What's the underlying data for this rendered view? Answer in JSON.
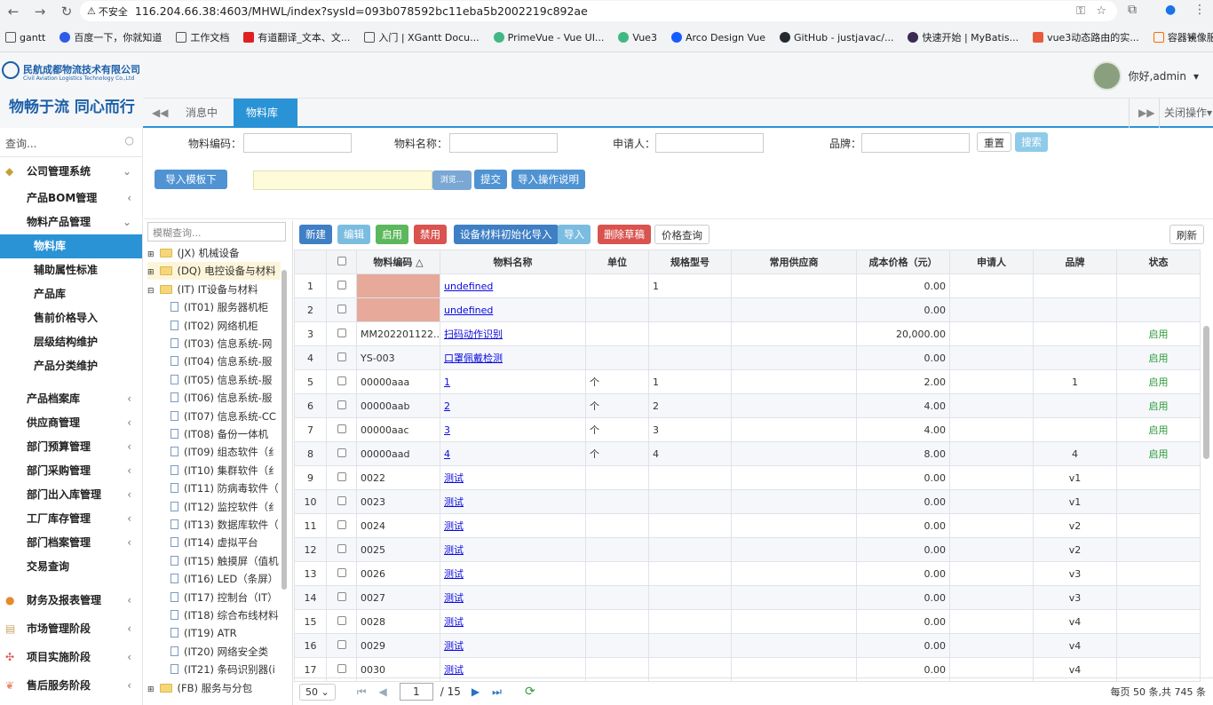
{
  "browser": {
    "insecure_label": "不安全",
    "url": "116.204.66.38:4603/MHWL/index?sysId=093b078592bc11eba5b2002219c892ae",
    "bookmarks": [
      "gantt",
      "百度一下，你就知道",
      "工作文档",
      "有道翻译_文本、文...",
      "入门 | XGantt Docu...",
      "PrimeVue - Vue UI...",
      "Vue3",
      "Arco Design Vue",
      "GitHub - justjavac/...",
      "快速开始 | MyBatis...",
      "vue3动态路由的实...",
      "容器镜像服务"
    ],
    "more": "»"
  },
  "brand": {
    "cn": "民航成都物流技术有限公司",
    "en": "Civil Aviation Logistics Technology Co.,Ltd",
    "slogan": "物畅于流 同心而行"
  },
  "user": {
    "greeting": "你好,admin"
  },
  "tabs": {
    "messages": "消息中心",
    "library": "物料库",
    "close_ops": "关闭操作"
  },
  "sidebar": {
    "search_placeholder": "查询...",
    "group1": "公司管理系统",
    "items": [
      "产品BOM管理",
      "物料产品管理",
      "物料库",
      "辅助属性标准",
      "产品库",
      "售前价格导入",
      "层级结构维护",
      "产品分类维护",
      "产品档案库",
      "供应商管理",
      "部门预算管理",
      "部门采购管理",
      "部门出入库管理",
      "工厂库存管理",
      "部门档案管理",
      "交易查询"
    ],
    "groups": [
      "财务及报表管理",
      "市场管理阶段",
      "项目实施阶段",
      "售后服务阶段"
    ]
  },
  "filter": {
    "code_label": "物料编码：",
    "name_label": "物料名称：",
    "applicant_label": "申请人：",
    "brand_label": "品牌：",
    "reset": "重置",
    "search": "搜索",
    "template": "导入模板下载",
    "browse": "浏览...",
    "submit": "提交",
    "instructions": "导入操作说明"
  },
  "tree": {
    "search_placeholder": "模糊查询...",
    "nodes": [
      "(JX) 机械设备",
      "(DQ) 电控设备与材料",
      "(IT) IT设备与材料",
      "(IT01) 服务器机柜",
      "(IT02) 网络机柜",
      "(IT03) 信息系统-网",
      "(IT04) 信息系统-服",
      "(IT05) 信息系统-服",
      "(IT06) 信息系统-服",
      "(IT07) 信息系统-CC",
      "(IT08) 备份一体机",
      "(IT09) 组态软件（纟",
      "(IT10) 集群软件（纟",
      "(IT11) 防病毒软件（",
      "(IT12) 监控软件（纟",
      "(IT13) 数据库软件（",
      "(IT14) 虚拟平台",
      "(IT15) 触摸屏（值机",
      "(IT16) LED（条屏）",
      "(IT17) 控制台（IT）",
      "(IT18) 综合布线材料",
      "(IT19) ATR",
      "(IT20) 网络安全类",
      "(IT21) 条码识别器(i",
      "(FB) 服务与分包"
    ]
  },
  "toolbar": {
    "new": "新建",
    "edit": "编辑",
    "enable": "启用",
    "disable": "禁用",
    "init_import": "设备材料初始化导入",
    "import": "导入",
    "delete_draft": "删除草稿",
    "price_query": "价格查询",
    "refresh": "刷新"
  },
  "table": {
    "headers": [
      "物料编码 △",
      "物料名称",
      "单位",
      "规格型号",
      "常用供应商",
      "成本价格（元）",
      "申请人",
      "品牌",
      "状态"
    ],
    "rows": [
      {
        "n": "1",
        "code": "",
        "name": "undefined",
        "unit": "",
        "spec": "1",
        "price": "0.00",
        "brand": "",
        "status": ""
      },
      {
        "n": "2",
        "code": "",
        "name": "undefined",
        "unit": "",
        "spec": "",
        "price": "0.00",
        "brand": "",
        "status": ""
      },
      {
        "n": "3",
        "code": "MM202201122...",
        "name": "扫码动作识别",
        "unit": "",
        "spec": "",
        "price": "20,000.00",
        "brand": "",
        "status": "启用"
      },
      {
        "n": "4",
        "code": "YS-003",
        "name": "口罩佩戴检测",
        "unit": "",
        "spec": "",
        "price": "0.00",
        "brand": "",
        "status": "启用"
      },
      {
        "n": "5",
        "code": "00000aaa",
        "name": "1",
        "unit": "个",
        "spec": "1",
        "price": "2.00",
        "brand": "1",
        "status": "启用"
      },
      {
        "n": "6",
        "code": "00000aab",
        "name": "2",
        "unit": "个",
        "spec": "2",
        "price": "4.00",
        "brand": "",
        "status": "启用"
      },
      {
        "n": "7",
        "code": "00000aac",
        "name": "3",
        "unit": "个",
        "spec": "3",
        "price": "4.00",
        "brand": "",
        "status": "启用"
      },
      {
        "n": "8",
        "code": "00000aad",
        "name": "4",
        "unit": "个",
        "spec": "4",
        "price": "8.00",
        "brand": "4",
        "status": "启用"
      },
      {
        "n": "9",
        "code": "0022",
        "name": "测试",
        "unit": "",
        "spec": "",
        "price": "0.00",
        "brand": "v1",
        "status": ""
      },
      {
        "n": "10",
        "code": "0023",
        "name": "测试",
        "unit": "",
        "spec": "",
        "price": "0.00",
        "brand": "v1",
        "status": ""
      },
      {
        "n": "11",
        "code": "0024",
        "name": "测试",
        "unit": "",
        "spec": "",
        "price": "0.00",
        "brand": "v2",
        "status": ""
      },
      {
        "n": "12",
        "code": "0025",
        "name": "测试",
        "unit": "",
        "spec": "",
        "price": "0.00",
        "brand": "v2",
        "status": ""
      },
      {
        "n": "13",
        "code": "0026",
        "name": "测试",
        "unit": "",
        "spec": "",
        "price": "0.00",
        "brand": "v3",
        "status": ""
      },
      {
        "n": "14",
        "code": "0027",
        "name": "测试",
        "unit": "",
        "spec": "",
        "price": "0.00",
        "brand": "v3",
        "status": ""
      },
      {
        "n": "15",
        "code": "0028",
        "name": "测试",
        "unit": "",
        "spec": "",
        "price": "0.00",
        "brand": "v4",
        "status": ""
      },
      {
        "n": "16",
        "code": "0029",
        "name": "测试",
        "unit": "",
        "spec": "",
        "price": "0.00",
        "brand": "v4",
        "status": ""
      },
      {
        "n": "17",
        "code": "0030",
        "name": "测试",
        "unit": "",
        "spec": "",
        "price": "0.00",
        "brand": "v4",
        "status": ""
      }
    ]
  },
  "pager": {
    "page_size": "50",
    "page": "1",
    "total_pages": "/ 15",
    "summary": "每页 50 条,共 745 条"
  },
  "colors": {
    "primary": "#337ab7",
    "info": "#5bc0de",
    "success": "#5cb85c",
    "danger": "#d9534f",
    "tab_active": "#2a93d5",
    "sidebar_active": "#2a93d5"
  }
}
